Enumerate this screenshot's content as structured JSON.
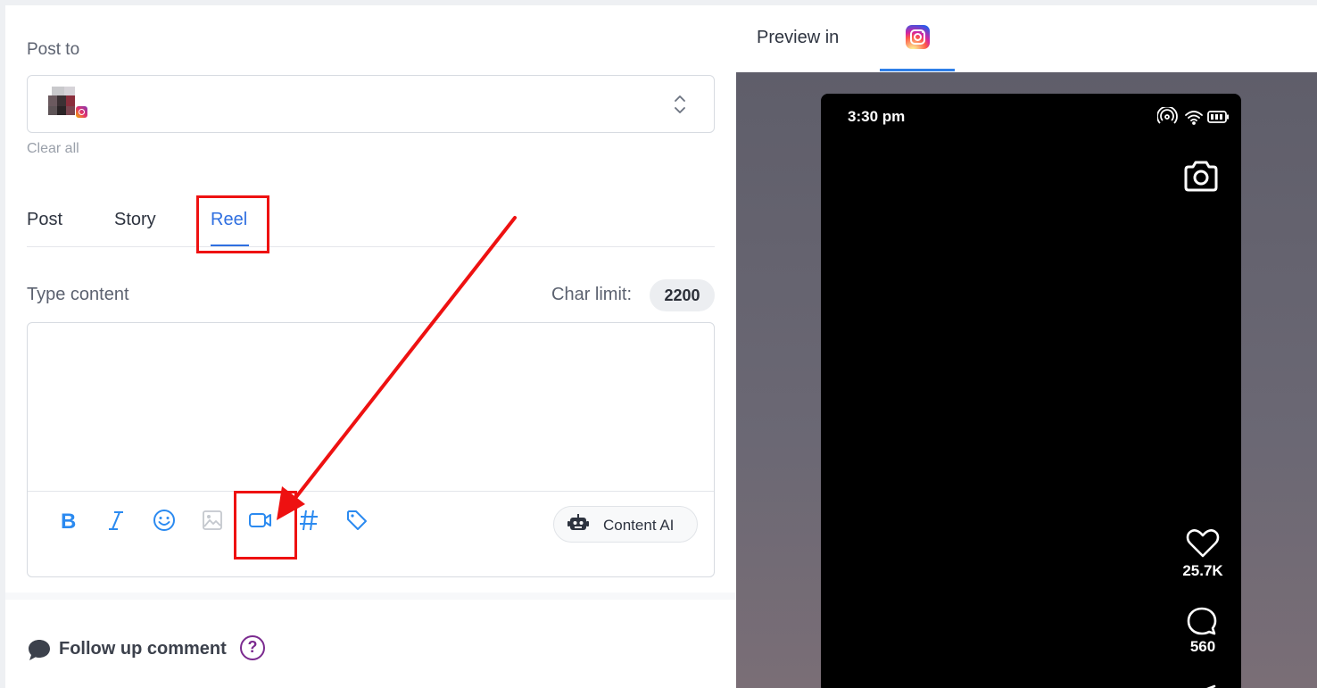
{
  "composer": {
    "post_to_label": "Post to",
    "clear_all": "Clear all",
    "tabs": [
      {
        "label": "Post",
        "active": false
      },
      {
        "label": "Story",
        "active": false
      },
      {
        "label": "Reel",
        "active": true
      }
    ],
    "type_content_label": "Type content",
    "char_limit_label": "Char limit:",
    "char_limit_value": "2200",
    "editor_text": "",
    "toolbar": [
      {
        "icon": "bold-icon"
      },
      {
        "icon": "italic-icon"
      },
      {
        "icon": "emoji-icon"
      },
      {
        "icon": "image-icon"
      },
      {
        "icon": "video-icon"
      },
      {
        "icon": "hashtag-icon"
      },
      {
        "icon": "tag-icon"
      }
    ],
    "content_ai_label": "Content AI",
    "follow_up_label": "Follow up comment",
    "help_glyph": "?"
  },
  "preview": {
    "label": "Preview in",
    "network_icon": "instagram-icon",
    "phone": {
      "time": "3:30 pm",
      "likes": "25.7K",
      "comments": "560"
    }
  },
  "colors": {
    "accent": "#2f6fe0",
    "annotation": "#ee1111",
    "toolbar_icon": "#2b8af0",
    "help_purple": "#7b2a8f"
  }
}
